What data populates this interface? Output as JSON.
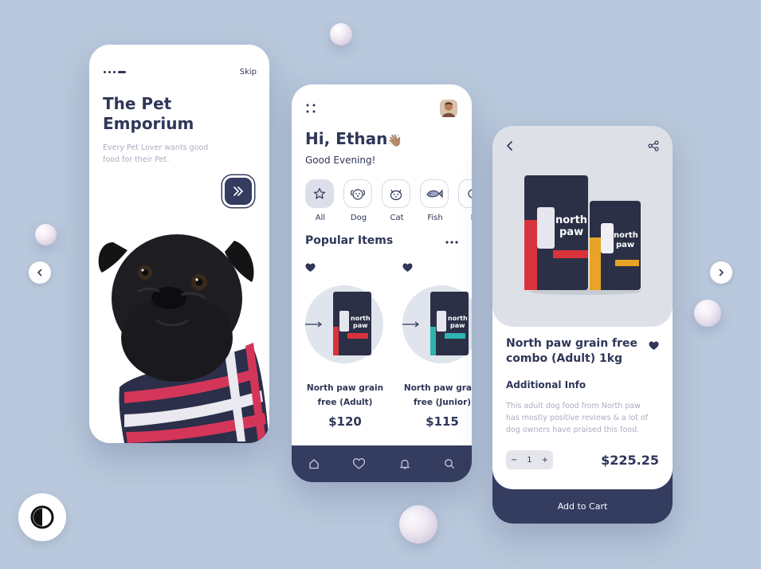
{
  "onboarding": {
    "skip_label": "Skip",
    "title": "The Pet Emporium",
    "subtitle": "Every Pet Lover wants good food for their Pet."
  },
  "home": {
    "greeting": "Hi, Ethan",
    "greeting_emoji": "👋🏽",
    "subgreeting": "Good Evening!",
    "categories": [
      {
        "label": "All",
        "icon": "star-icon",
        "active": true
      },
      {
        "label": "Dog",
        "icon": "dog-icon"
      },
      {
        "label": "Cat",
        "icon": "cat-icon"
      },
      {
        "label": "Fish",
        "icon": "fish-icon"
      },
      {
        "label": "B",
        "icon": "bird-icon"
      }
    ],
    "section_title": "Popular Items",
    "products": [
      {
        "name_line1": "North paw grain",
        "name_line2": "free (Adult)",
        "price": "$120",
        "bag_color": "#d8333d"
      },
      {
        "name_line1": "North paw grain",
        "name_line2": "free (Junior)",
        "price": "$115",
        "bag_color": "#2fb4b0"
      }
    ],
    "bottom_nav": [
      "home-icon",
      "heart-icon",
      "bell-icon",
      "search-icon"
    ]
  },
  "detail": {
    "title": "North paw grain free combo (Adult) 1kg",
    "section": "Additional Info",
    "description": "This adult dog food from North paw has mostly positive reviews & a lot of dog owners have praised this food.",
    "qty_minus": "−",
    "qty_value": "1",
    "qty_plus": "+",
    "price": "$225.25",
    "cart_label": "Add to Cart",
    "bag_brand": "north paw"
  },
  "colors": {
    "background": "#b9c8dc",
    "navy": "#343c60",
    "muted_text": "#a9aebf",
    "red": "#d8333d",
    "orange": "#e8a426",
    "teal": "#2fb4b0"
  }
}
